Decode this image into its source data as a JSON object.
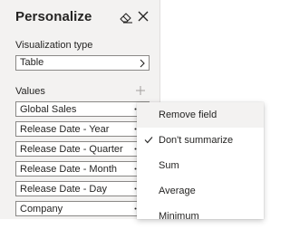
{
  "panel": {
    "title": "Personalize",
    "viz_label": "Visualization type",
    "viz_value": "Table",
    "values_label": "Values",
    "fields": [
      {
        "label": "Global Sales"
      },
      {
        "label": "Release Date - Year"
      },
      {
        "label": "Release Date - Quarter"
      },
      {
        "label": "Release Date - Month"
      },
      {
        "label": "Release Date - Day"
      },
      {
        "label": "Company"
      }
    ],
    "icons": {
      "eraser": "eraser-icon",
      "close": "close-icon",
      "chevron": "chevron-right-icon",
      "add": "add-icon",
      "more": "more-icon"
    }
  },
  "context_menu": {
    "items": [
      {
        "label": "Remove field",
        "checked": false
      },
      {
        "label": "Don't summarize",
        "checked": true
      },
      {
        "label": "Sum",
        "checked": false
      },
      {
        "label": "Average",
        "checked": false
      },
      {
        "label": "Minimum",
        "checked": false
      }
    ]
  },
  "colors": {
    "panel_bg": "#f3f2f1",
    "border": "#8a8886",
    "text": "#252423",
    "hover": "#f3f2f1"
  }
}
